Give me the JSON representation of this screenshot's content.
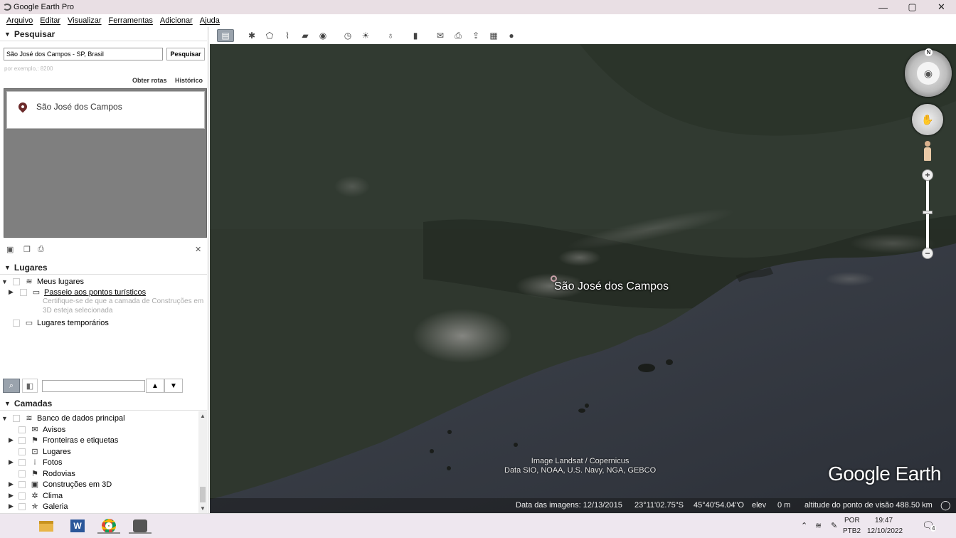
{
  "window": {
    "title": "Google Earth Pro",
    "minimize": "—",
    "maximize": "▢",
    "close": "✕"
  },
  "menu": [
    "Arquivo",
    "Editar",
    "Visualizar",
    "Ferramentas",
    "Adicionar",
    "Ajuda"
  ],
  "toolbar_icons": [
    "sidebar-toggle-icon",
    "placemark-icon",
    "polygon-icon",
    "path-icon",
    "image-overlay-icon",
    "record-tour-icon",
    "historical-imagery-icon",
    "sun-icon",
    "planets-icon",
    "ruler-icon",
    "email-icon",
    "print-icon",
    "save-image-icon",
    "view-in-maps-icon",
    "sky-icon"
  ],
  "search": {
    "heading": "Pesquisar",
    "query": "São José dos Campos - SP, Brasil",
    "button": "Pesquisar",
    "hint": "por exemplo,: 8200",
    "directions": "Obter rotas",
    "history": "Histórico",
    "result": "São José dos Campos"
  },
  "places": {
    "heading": "Lugares",
    "my_places": "Meus lugares",
    "tour": "Passeio aos pontos turísticos",
    "tour_note_line1": "Certifique-se de que a camada de Construções em",
    "tour_note_line2": "3D esteja selecionada",
    "temporary": "Lugares temporários"
  },
  "layers": {
    "heading": "Camadas",
    "primary_db": "Banco de dados principal",
    "items": [
      "Avisos",
      "Fronteiras e etiquetas",
      "Lugares",
      "Fotos",
      "Rodovias",
      "Construções em 3D",
      "Clima",
      "Galeria"
    ]
  },
  "map": {
    "place_label": "São José dos Campos",
    "credit_line1": "Image Landsat / Copernicus",
    "credit_line2": "Data SIO, NOAA, U.S. Navy, NGA, GEBCO",
    "brand": "Google Earth",
    "compass_north": "N",
    "status": {
      "imagery_date": "Data das imagens: 12/13/2015",
      "lat": "23°11'02.75\"S",
      "lon": "45°40'54.04\"O",
      "elev_label": "elev",
      "elev_value": "0 m",
      "eye_alt": "altitude do ponto de visão 488.50 km"
    }
  },
  "taskbar": {
    "lang_top": "POR",
    "lang_bottom": "PTB2",
    "time": "19:47",
    "date": "12/10/2022",
    "notifications": "4"
  },
  "colors": {
    "land": "#2c332b",
    "ocean": "#3a3f47",
    "urban": "#8a8a86"
  }
}
